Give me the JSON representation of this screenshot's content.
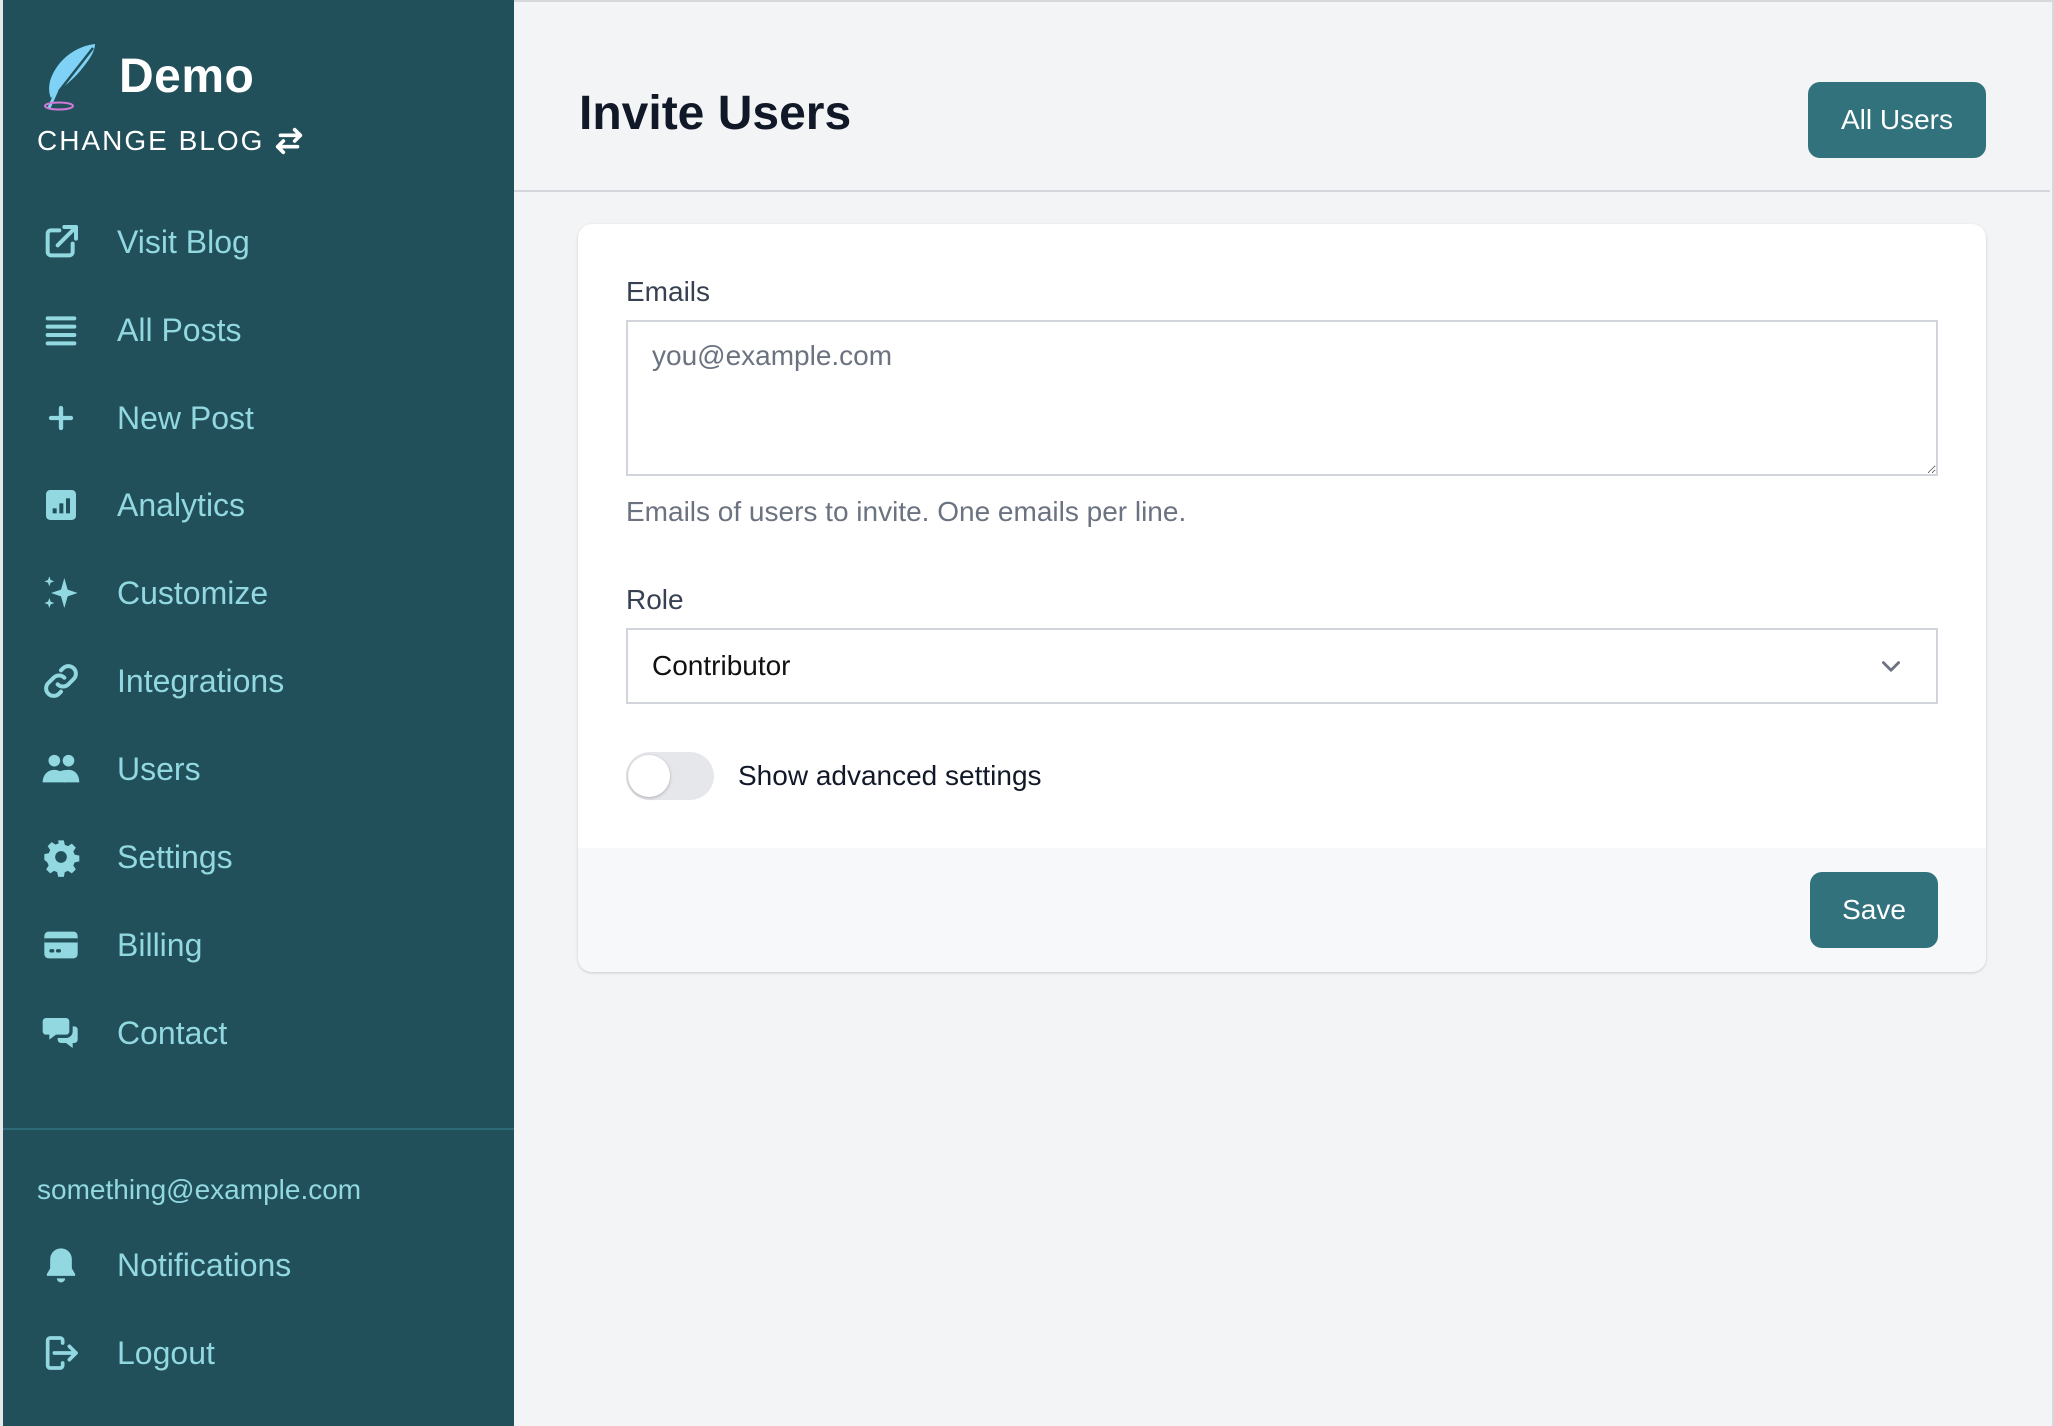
{
  "sidebar": {
    "brand_name": "Demo",
    "change_blog_label": "CHANGE BLOG",
    "items": [
      {
        "label": "Visit Blog",
        "icon": "external-link-icon"
      },
      {
        "label": "All Posts",
        "icon": "list-icon"
      },
      {
        "label": "New Post",
        "icon": "plus-icon"
      },
      {
        "label": "Analytics",
        "icon": "chart-icon"
      },
      {
        "label": "Customize",
        "icon": "sparkles-icon"
      },
      {
        "label": "Integrations",
        "icon": "link-icon"
      },
      {
        "label": "Users",
        "icon": "users-icon"
      },
      {
        "label": "Settings",
        "icon": "gear-icon"
      },
      {
        "label": "Billing",
        "icon": "credit-card-icon"
      },
      {
        "label": "Contact",
        "icon": "chat-icon"
      }
    ],
    "user_email": "something@example.com",
    "bottom_items": [
      {
        "label": "Notifications",
        "icon": "bell-icon"
      },
      {
        "label": "Logout",
        "icon": "logout-icon"
      }
    ]
  },
  "header": {
    "title": "Invite Users",
    "all_users_label": "All Users"
  },
  "form": {
    "emails_label": "Emails",
    "emails_value": "",
    "emails_placeholder": "you@example.com",
    "emails_help": "Emails of users to invite. One emails per line.",
    "role_label": "Role",
    "role_value": "Contributor",
    "advanced_toggle_label": "Show advanced settings",
    "advanced_toggle_on": false,
    "save_label": "Save"
  },
  "colors": {
    "sidebar_bg": "#214f5a",
    "sidebar_text": "#92d8e0",
    "accent": "#31727c",
    "page_bg": "#f3f4f6"
  }
}
